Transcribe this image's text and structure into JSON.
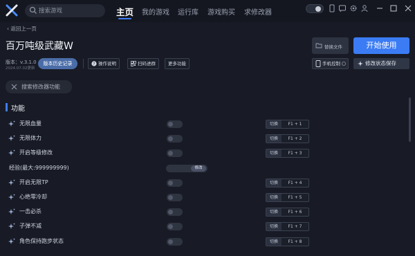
{
  "topbar": {
    "search_placeholder": "搜索游戏",
    "nav": [
      "主页",
      "我的游戏",
      "运行库",
      "游戏购买",
      "求修改器"
    ],
    "active_nav": "主页"
  },
  "header": {
    "back_label": "返回上一页",
    "game_title": "百万吨级武藏W",
    "folder_button": "替换文件",
    "start_button": "开始使用",
    "version": "版本：v.3.1.0",
    "version_date": "2024.07.02更新",
    "history_button": "版本历史记录",
    "actions": [
      "操作说明",
      "扫码进群",
      "更多功能"
    ],
    "mobile_control": "手机控制",
    "save_state": "修改状态保存"
  },
  "mod_search_placeholder": "搜索修改器功能",
  "section_title": "功能",
  "switch_label": "切换",
  "edit_label": "修改",
  "features": [
    {
      "name": "无限血量",
      "type": "toggle",
      "key": "F1 + 1"
    },
    {
      "name": "无限体力",
      "type": "toggle",
      "key": "F1 + 2"
    },
    {
      "name": "开启等级修改",
      "type": "toggle",
      "key": "F1 + 3"
    },
    {
      "name": "经验(最大:999999999)",
      "type": "input",
      "key": ""
    },
    {
      "name": "开启无限TP",
      "type": "toggle",
      "key": "F1 + 4"
    },
    {
      "name": "心绝零冷却",
      "type": "toggle",
      "key": "F1 + 5"
    },
    {
      "name": "一击必杀",
      "type": "toggle",
      "key": "F1 + 6"
    },
    {
      "name": "子弹不减",
      "type": "toggle",
      "key": "F1 + 7"
    },
    {
      "name": "角色保持跑步状态",
      "type": "toggle",
      "key": "F1 + 8"
    }
  ],
  "colors": {
    "accent": "#3b7cf5",
    "background": "#181b25",
    "topbar": "#14171f"
  }
}
